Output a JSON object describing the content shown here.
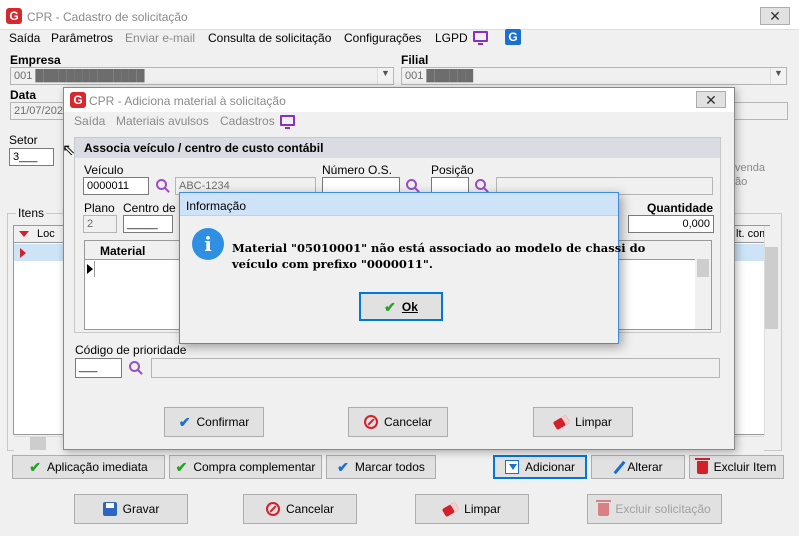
{
  "main": {
    "title": "CPR - Cadastro de solicitação",
    "close": "✕",
    "menu": [
      "Saída",
      "Parâmetros",
      "Enviar e-mail",
      "Consulta de solicitação",
      "Configurações",
      "LGPD"
    ],
    "empresa_label": "Empresa",
    "empresa_value": "001 ██████████████",
    "filial_label": "Filial",
    "filial_value": "001 ██████",
    "data_label": "Data",
    "data_value": "21/07/202",
    "setor_label": "Setor",
    "setor_value": "3___",
    "itens_label": "Itens",
    "loc_col": "Loc",
    "venda_text": "venda",
    "ao_text": "ão",
    "lt_com_text": "lt. com",
    "buttons_row1": [
      "Aplicação imediata",
      "Compra complementar",
      "Marcar todos",
      "Adicionar",
      "Alterar",
      "Excluir Item"
    ],
    "buttons_row2": [
      "Gravar",
      "Cancelar",
      "Limpar",
      "Excluir solicitação"
    ]
  },
  "sub": {
    "title": "CPR - Adiciona material à solicitação",
    "close": "✕",
    "menu": [
      "Saída",
      "Materiais avulsos",
      "Cadastros"
    ],
    "section_header": "Associa veículo / centro de custo contábil",
    "veiculo_label": "Veículo",
    "veiculo_value": "0000011",
    "placa_value": "ABC-1234",
    "numero_os_label": "Número O.S.",
    "posicao_label": "Posição",
    "plano_label": "Plano",
    "plano_value": "2",
    "centro_label": "Centro de c",
    "centro_value": "_____",
    "quantidade_label": "Quantidade",
    "quantidade_value": "0,000",
    "material_col": "Material",
    "prioridade_label": "Código de prioridade",
    "prioridade_value": "___",
    "buttons": [
      "Confirmar",
      "Cancelar",
      "Limpar"
    ]
  },
  "dialog": {
    "title": "Informação",
    "info_icon": "i",
    "message_line1": "Material \"05010001\" não está associado ao modelo de chassi do",
    "message_line2": "veículo com prefixo \"0000011\".",
    "ok_label": "Ok"
  }
}
